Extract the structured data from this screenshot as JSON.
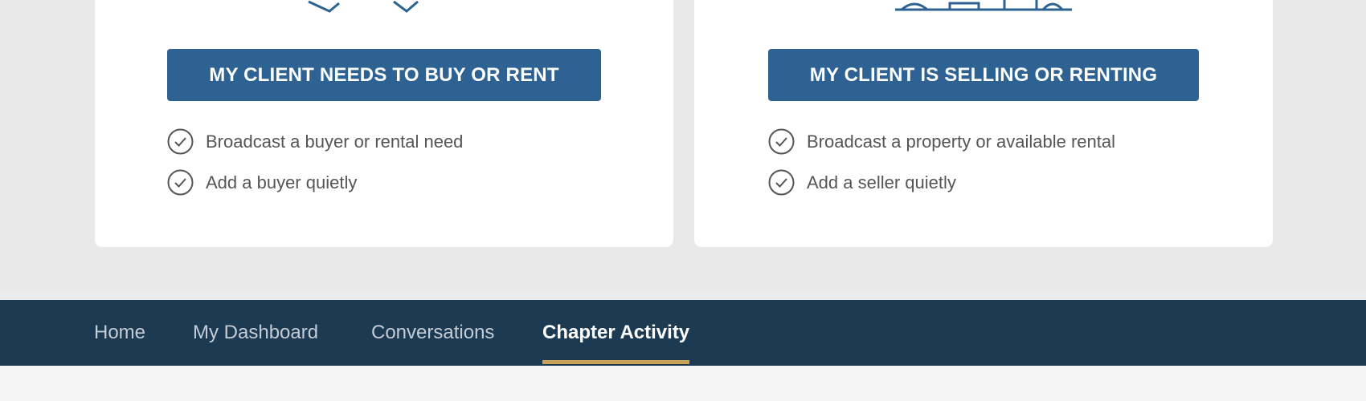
{
  "cards": {
    "buyer": {
      "icon": "tag-icon",
      "button_label": "MY CLIENT NEEDS TO BUY OR RENT",
      "features": [
        "Broadcast a buyer or rental need",
        "Add a buyer quietly"
      ]
    },
    "seller": {
      "icon": "property-icon",
      "button_label": "MY CLIENT IS SELLING OR RENTING",
      "features": [
        "Broadcast a property or available rental",
        "Add a seller quietly"
      ]
    }
  },
  "nav": {
    "items": [
      {
        "label": "Home",
        "active": false
      },
      {
        "label": "My Dashboard",
        "active": false
      },
      {
        "label": "Conversations",
        "active": false
      },
      {
        "label": "Chapter Activity",
        "active": true
      }
    ]
  },
  "colors": {
    "button": "#2d6292",
    "nav_bg": "#1c3a52",
    "nav_active_underline": "#c9a25a"
  }
}
